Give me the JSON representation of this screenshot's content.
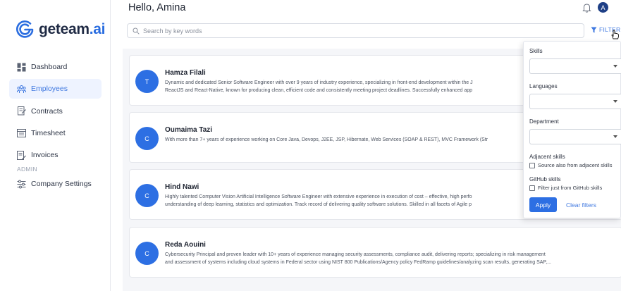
{
  "brand": {
    "name_main": "geteam",
    "name_suffix": ".ai",
    "accent": "#2a6de0"
  },
  "sidebar": {
    "items": [
      {
        "label": "Dashboard",
        "icon": "dashboard-icon"
      },
      {
        "label": "Employees",
        "icon": "employees-icon",
        "active": true
      },
      {
        "label": "Contracts",
        "icon": "contracts-icon"
      },
      {
        "label": "Timesheet",
        "icon": "timesheet-icon"
      },
      {
        "label": "Invoices",
        "icon": "invoices-icon"
      }
    ],
    "section_label": "ADMIN",
    "admin_items": [
      {
        "label": "Company Settings",
        "icon": "settings-sliders-icon"
      }
    ]
  },
  "header": {
    "greeting": "Hello, Amina",
    "avatar_initial": "A"
  },
  "search": {
    "placeholder": "Search by key words",
    "value": ""
  },
  "filter_button": {
    "label": "FILTER"
  },
  "employees": [
    {
      "initial": "T",
      "name": "Hamza Filali",
      "description_line1": "Dynamic and dedicated Senior Software Engineer with over 9 years of industry experience, specializing in front-end development within the J",
      "description_line2": "ReactJS and React-Native, known for producing clean, efficient code and consistently meeting project deadlines. Successfully enhanced app"
    },
    {
      "initial": "C",
      "name": "Oumaima Tazi",
      "description_line1": "With more than 7+ years of experience working on Core Java, Devops, J2EE, JSP, Hibernate, Web Services (SOAP & REST), MVC Framework (Str",
      "description_line2": ""
    },
    {
      "initial": "C",
      "name": "Hind Nawi",
      "description_line1": "Highly talented Computer Vision Artificial Intelligence Software Engineer with extensive experience in execution of cost – effective, high perfo",
      "description_line2": "understanding of deep learning, statistics and optimization. Track record of delivering quality software solutions. Skilled in all facets of Agile p"
    },
    {
      "initial": "C",
      "name": "Reda Aouini",
      "description_line1": "Cybersecurity Principal and proven leader with 10+ years of experience managing security assessments, compliance audit, delivering reports; specializing in risk management",
      "description_line2": "and assessment of systems including cloud systems in Federal sector using NIST 800 Publications/Agency policy FedRamp guidelines/analyzing scan results, generating SAP,..."
    }
  ],
  "filter_panel": {
    "skills_label": "Skills",
    "languages_label": "Languages",
    "department_label": "Department",
    "adjacent_title": "Adjacent skills",
    "adjacent_option": "Source also from adjacent skills",
    "github_title": "GitHub skills",
    "github_option": "Filter just from GitHub skills",
    "apply_label": "Apply",
    "clear_label": "Clear filters"
  }
}
